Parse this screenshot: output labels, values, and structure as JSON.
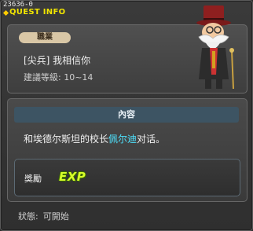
{
  "window": {
    "quest_id": "23636-0",
    "title": "QUEST INFO"
  },
  "job": {
    "badge_label": "職業",
    "quest_name": "[尖兵] 我相信你",
    "level_label": "建議等級: 10~14"
  },
  "content": {
    "header": "內容",
    "text_before": "和埃德尔斯坦的校长",
    "text_highlight": "佩尔迪",
    "text_after": "对话。"
  },
  "reward": {
    "label": "獎勵",
    "exp_text": "EXP"
  },
  "status": {
    "label": "狀態:",
    "value": "可開始"
  },
  "colors": {
    "title": "#f2e600",
    "highlight": "#4ee3ff",
    "exp": "#d7ff2a",
    "badge_bg": "#d9c7a6"
  }
}
